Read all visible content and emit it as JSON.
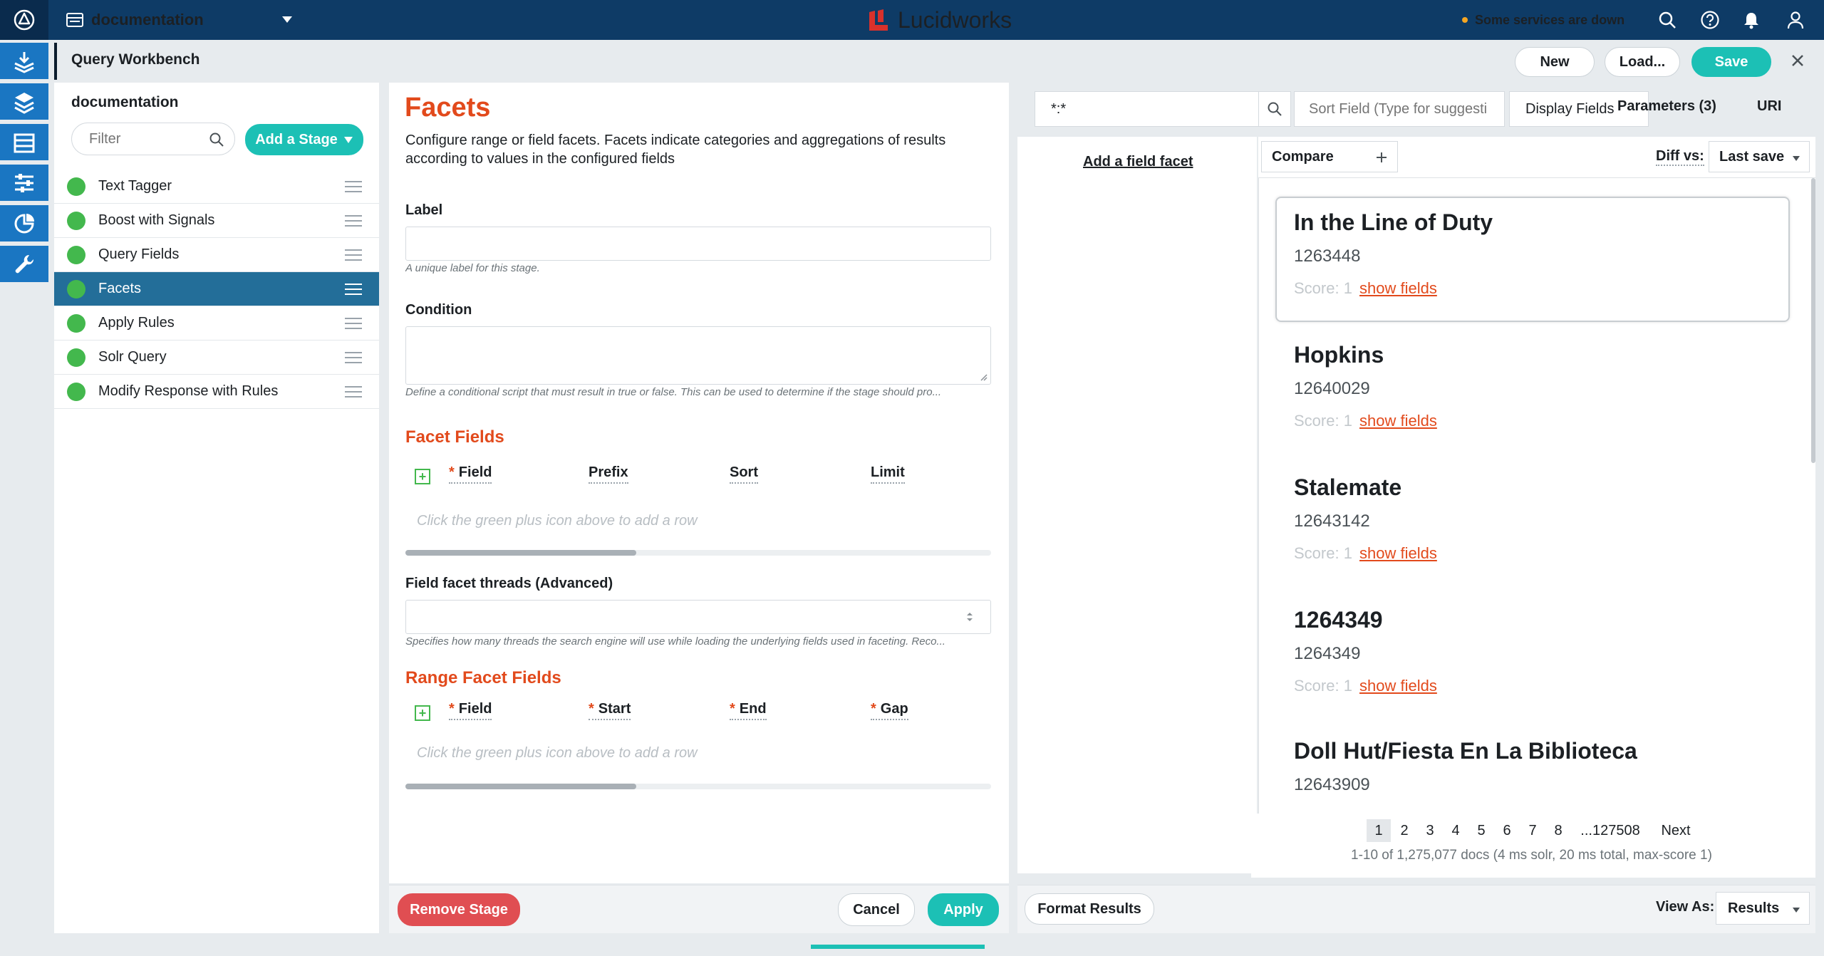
{
  "topbar": {
    "app_name": "documentation",
    "brand": "Lucidworks",
    "status_text": "Some services are down",
    "colors": {
      "bg": "#0e3b66",
      "brand_red": "#d9312b",
      "status": "#f5a623"
    }
  },
  "header": {
    "title": "Query Workbench",
    "buttons": {
      "new": "New",
      "load": "Load...",
      "save": "Save"
    }
  },
  "stages": {
    "collection": "documentation",
    "filter_placeholder": "Filter",
    "add_stage": "Add a Stage",
    "items": [
      {
        "label": "Text Tagger",
        "active": false
      },
      {
        "label": "Boost with Signals",
        "active": false
      },
      {
        "label": "Query Fields",
        "active": false
      },
      {
        "label": "Facets",
        "active": true
      },
      {
        "label": "Apply Rules",
        "active": false
      },
      {
        "label": "Solr Query",
        "active": false
      },
      {
        "label": "Modify Response with Rules",
        "active": false
      }
    ]
  },
  "config": {
    "title": "Facets",
    "description": "Configure range or field facets. Facets indicate categories and aggregations of results according to values in the configured fields",
    "label_field": {
      "label": "Label",
      "value": "",
      "hint": "A unique label for this stage."
    },
    "condition_field": {
      "label": "Condition",
      "value": "",
      "hint": "Define a conditional script that must result in true or false. This can be used to determine if the stage should pro..."
    },
    "facet_fields": {
      "title": "Facet Fields",
      "columns": [
        "Field",
        "Prefix",
        "Sort",
        "Limit"
      ],
      "empty": "Click the green plus icon above to add a row"
    },
    "threads_field": {
      "label": "Field facet threads (Advanced)",
      "value": "",
      "hint": "Specifies how many threads the search engine will use while loading the underlying fields used in faceting. Reco..."
    },
    "range_facet_fields": {
      "title": "Range Facet Fields",
      "columns": [
        "Field",
        "Start",
        "End",
        "Gap"
      ],
      "empty": "Click the green plus icon above to add a row"
    },
    "buttons": {
      "remove": "Remove Stage",
      "cancel": "Cancel",
      "apply": "Apply"
    }
  },
  "search": {
    "query": "*:*",
    "sort_placeholder": "Sort Field (Type for suggesti",
    "display_fields": "Display Fields",
    "parameters": "Parameters (3)",
    "uri": "URI"
  },
  "facets_pane": {
    "add_facet": "Add a field facet"
  },
  "results": {
    "compare": "Compare",
    "diff_label": "Diff vs:",
    "diff_value": "Last save",
    "score_label": "Score:",
    "show_fields": "show fields",
    "items": [
      {
        "title": "In the Line of Duty",
        "id": "1263448",
        "score": "1"
      },
      {
        "title": "Hopkins",
        "id": "12640029",
        "score": "1"
      },
      {
        "title": "Stalemate",
        "id": "12643142",
        "score": "1"
      },
      {
        "title": "1264349",
        "id": "1264349",
        "score": "1"
      },
      {
        "title": "Doll Hut/Fiesta En La Biblioteca",
        "id": "12643909",
        "score": null
      }
    ],
    "pagination": [
      "1",
      "2",
      "3",
      "4",
      "5",
      "6",
      "7",
      "8",
      "...127508"
    ],
    "next": "Next",
    "summary": "1-10 of 1,275,077 docs (4 ms solr, 20 ms total, max-score 1)",
    "format_results": "Format Results",
    "view_as_label": "View As:",
    "view_as_value": "Results"
  }
}
